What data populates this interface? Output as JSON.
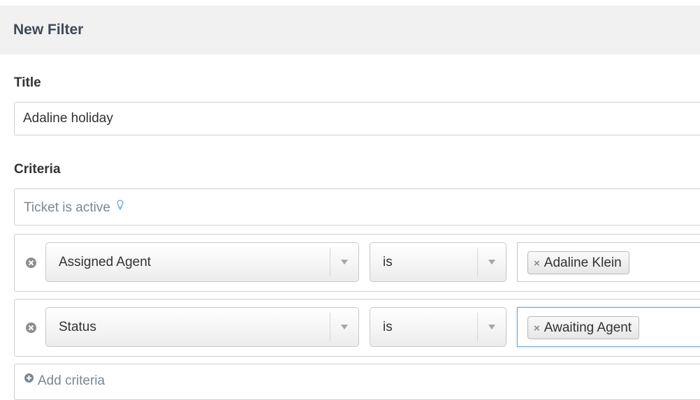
{
  "header": {
    "title": "New Filter"
  },
  "title_section": {
    "label": "Title",
    "value": "Adaline holiday"
  },
  "criteria_section": {
    "label": "Criteria",
    "active_hint": "Ticket is active",
    "rows": [
      {
        "field": "Assigned Agent",
        "operator": "is",
        "value_tag": "Adaline Klein"
      },
      {
        "field": "Status",
        "operator": "is",
        "value_tag": "Awaiting Agent"
      }
    ],
    "add_label": "Add criteria"
  },
  "icons": {
    "remove": "remove-circle-icon",
    "bulb": "lightbulb-icon",
    "add": "add-circle-icon",
    "dropdown": "dropdown-arrow-icon",
    "tag_remove": "tag-remove-icon"
  },
  "colors": {
    "header_bg": "#f1f1f1",
    "header_text": "#3d4a57",
    "focus_border": "#7aa6d6",
    "muted_text": "#7c8791"
  }
}
